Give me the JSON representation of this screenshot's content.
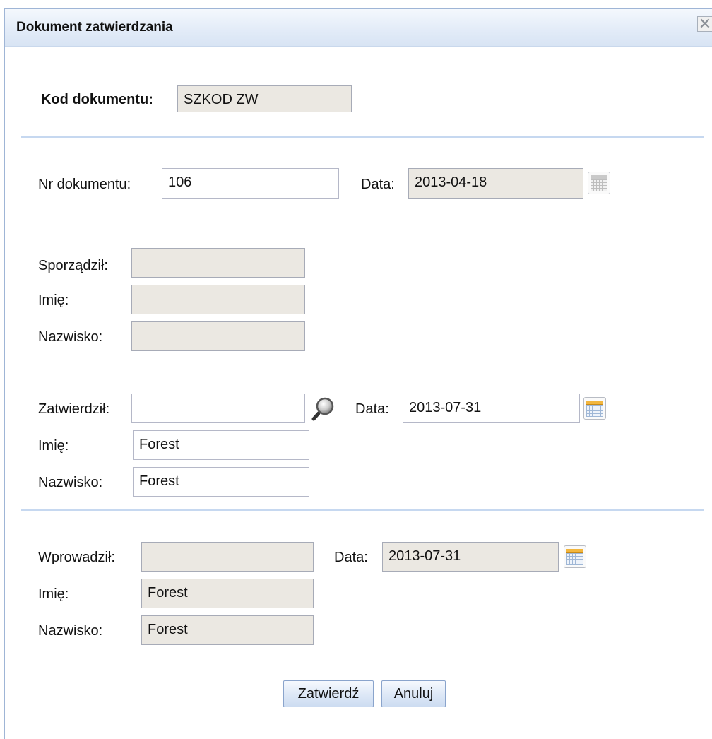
{
  "dialog": {
    "title": "Dokument zatwierdzania",
    "close_glyph": "✕"
  },
  "kod": {
    "label": "Kod dokumentu:",
    "value": "SZKOD ZW"
  },
  "nr": {
    "label": "Nr dokumentu:",
    "value": "106",
    "date_label": "Data:",
    "date_value": "2013-04-18"
  },
  "sporzadzil": {
    "label": "Sporządził:",
    "value": "",
    "imie_label": "Imię:",
    "imie_value": "",
    "nazwisko_label": "Nazwisko:",
    "nazwisko_value": ""
  },
  "zatwierdzil": {
    "label": "Zatwierdził:",
    "value": "",
    "date_label": "Data:",
    "date_value": "2013-07-31",
    "imie_label": "Imię:",
    "imie_value": "Forest",
    "nazwisko_label": "Nazwisko:",
    "nazwisko_value": "Forest"
  },
  "wprowadzil": {
    "label": "Wprowadził:",
    "value": "",
    "date_label": "Data:",
    "date_value": "2013-07-31",
    "imie_label": "Imię:",
    "imie_value": "Forest",
    "nazwisko_label": "Nazwisko:",
    "nazwisko_value": "Forest"
  },
  "buttons": {
    "confirm": "Zatwierdź",
    "cancel": "Anuluj"
  },
  "icons": {
    "calendar": "calendar-icon",
    "search": "search-icon",
    "close": "close-icon"
  },
  "colors": {
    "titlebar": "#dfe9f6",
    "separator": "#c6d8f0",
    "readonly_field": "#ebe8e2",
    "button": "#dfe9f7"
  }
}
